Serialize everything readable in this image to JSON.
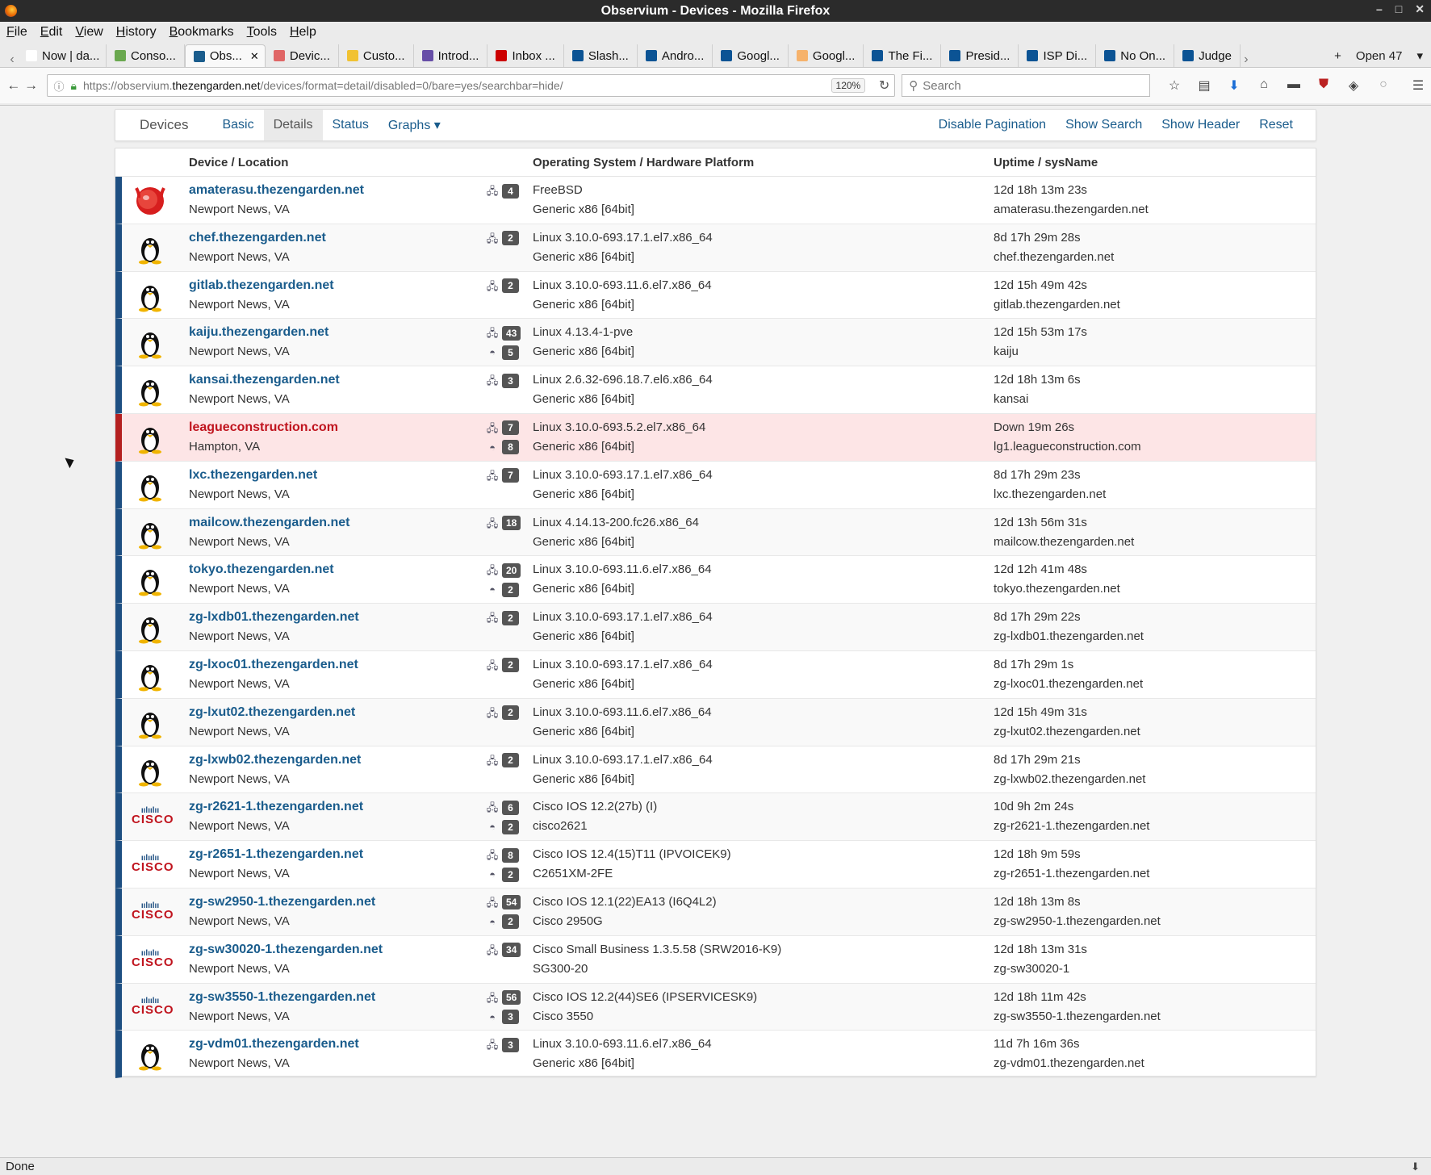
{
  "window": {
    "title": "Observium - Devices - Mozilla Firefox"
  },
  "menubar": [
    "File",
    "Edit",
    "View",
    "History",
    "Bookmarks",
    "Tools",
    "Help"
  ],
  "tabs": [
    {
      "label": "Now | da...",
      "color": "#ffffff"
    },
    {
      "label": "Conso...",
      "color": "#6aa84f"
    },
    {
      "label": "Obs...",
      "color": "#1a5c8c",
      "active": true
    },
    {
      "label": "Devic...",
      "color": "#e06666"
    },
    {
      "label": "Custo...",
      "color": "#f1c232"
    },
    {
      "label": "Introd...",
      "color": "#674ea7"
    },
    {
      "label": "Inbox ...",
      "color": "#cc0000"
    },
    {
      "label": "Slash...",
      "color": "#0b5394"
    },
    {
      "label": "Andro...",
      "color": "#0b5394"
    },
    {
      "label": "Googl...",
      "color": "#0b5394"
    },
    {
      "label": "Googl...",
      "color": "#f6b26b"
    },
    {
      "label": "The Fi...",
      "color": "#0b5394"
    },
    {
      "label": "Presid...",
      "color": "#0b5394"
    },
    {
      "label": "ISP Di...",
      "color": "#0b5394"
    },
    {
      "label": "No On...",
      "color": "#0b5394"
    },
    {
      "label": "Judge",
      "color": "#0b5394"
    }
  ],
  "tab_overflow": "Open 47",
  "url": {
    "prefix": "https://observium.",
    "domain": "thezengarden.net",
    "path": "/devices/format=detail/disabled=0/bare=yes/searchbar=hide/",
    "zoom": "120%"
  },
  "search_placeholder": "Search",
  "nav": {
    "brand": "Devices",
    "links": [
      "Basic",
      "Details",
      "Status",
      "Graphs ▾"
    ],
    "right": [
      "Disable Pagination",
      "Show Search",
      "Show Header",
      "Reset"
    ]
  },
  "columns": {
    "device": "Device / Location",
    "os": "Operating System / Hardware Platform",
    "uptime": "Uptime / sysName"
  },
  "devices": [
    {
      "host": "amaterasu.thezengarden.net",
      "location": "Newport News, VA",
      "os": "FreeBSD",
      "hw": "Generic x86 [64bit]",
      "uptime": "12d 18h 13m 23s",
      "sysname": "amaterasu.thezengarden.net",
      "ports": "4",
      "sensors": "",
      "icon": "freebsd-icon",
      "status": "up"
    },
    {
      "host": "chef.thezengarden.net",
      "location": "Newport News, VA",
      "os": "Linux 3.10.0-693.17.1.el7.x86_64",
      "hw": "Generic x86 [64bit]",
      "uptime": "8d 17h 29m 28s",
      "sysname": "chef.thezengarden.net",
      "ports": "2",
      "sensors": "",
      "icon": "linux-icon",
      "status": "up"
    },
    {
      "host": "gitlab.thezengarden.net",
      "location": "Newport News, VA",
      "os": "Linux 3.10.0-693.11.6.el7.x86_64",
      "hw": "Generic x86 [64bit]",
      "uptime": "12d 15h 49m 42s",
      "sysname": "gitlab.thezengarden.net",
      "ports": "2",
      "sensors": "",
      "icon": "linux-icon",
      "status": "up"
    },
    {
      "host": "kaiju.thezengarden.net",
      "location": "Newport News, VA",
      "os": "Linux 4.13.4-1-pve",
      "hw": "Generic x86 [64bit]",
      "uptime": "12d 15h 53m 17s",
      "sysname": "kaiju",
      "ports": "43",
      "sensors": "5",
      "icon": "linux-icon",
      "status": "up"
    },
    {
      "host": "kansai.thezengarden.net",
      "location": "Newport News, VA",
      "os": "Linux 2.6.32-696.18.7.el6.x86_64",
      "hw": "Generic x86 [64bit]",
      "uptime": "12d 18h 13m 6s",
      "sysname": "kansai",
      "ports": "3",
      "sensors": "",
      "icon": "linux-icon",
      "status": "up"
    },
    {
      "host": "leagueconstruction.com",
      "location": "Hampton, VA",
      "os": "Linux 3.10.0-693.5.2.el7.x86_64",
      "hw": "Generic x86 [64bit]",
      "uptime": "Down 19m 26s",
      "sysname": "lg1.leagueconstruction.com",
      "ports": "7",
      "sensors": "8",
      "icon": "linux-icon",
      "status": "down"
    },
    {
      "host": "lxc.thezengarden.net",
      "location": "Newport News, VA",
      "os": "Linux 3.10.0-693.17.1.el7.x86_64",
      "hw": "Generic x86 [64bit]",
      "uptime": "8d 17h 29m 23s",
      "sysname": "lxc.thezengarden.net",
      "ports": "7",
      "sensors": "",
      "icon": "linux-icon",
      "status": "up"
    },
    {
      "host": "mailcow.thezengarden.net",
      "location": "Newport News, VA",
      "os": "Linux 4.14.13-200.fc26.x86_64",
      "hw": "Generic x86 [64bit]",
      "uptime": "12d 13h 56m 31s",
      "sysname": "mailcow.thezengarden.net",
      "ports": "18",
      "sensors": "",
      "icon": "linux-icon",
      "status": "up"
    },
    {
      "host": "tokyo.thezengarden.net",
      "location": "Newport News, VA",
      "os": "Linux 3.10.0-693.11.6.el7.x86_64",
      "hw": "Generic x86 [64bit]",
      "uptime": "12d 12h 41m 48s",
      "sysname": "tokyo.thezengarden.net",
      "ports": "20",
      "sensors": "2",
      "icon": "linux-icon",
      "status": "up"
    },
    {
      "host": "zg-lxdb01.thezengarden.net",
      "location": "Newport News, VA",
      "os": "Linux 3.10.0-693.17.1.el7.x86_64",
      "hw": "Generic x86 [64bit]",
      "uptime": "8d 17h 29m 22s",
      "sysname": "zg-lxdb01.thezengarden.net",
      "ports": "2",
      "sensors": "",
      "icon": "linux-icon",
      "status": "up"
    },
    {
      "host": "zg-lxoc01.thezengarden.net",
      "location": "Newport News, VA",
      "os": "Linux 3.10.0-693.17.1.el7.x86_64",
      "hw": "Generic x86 [64bit]",
      "uptime": "8d 17h 29m 1s",
      "sysname": "zg-lxoc01.thezengarden.net",
      "ports": "2",
      "sensors": "",
      "icon": "linux-icon",
      "status": "up"
    },
    {
      "host": "zg-lxut02.thezengarden.net",
      "location": "Newport News, VA",
      "os": "Linux 3.10.0-693.11.6.el7.x86_64",
      "hw": "Generic x86 [64bit]",
      "uptime": "12d 15h 49m 31s",
      "sysname": "zg-lxut02.thezengarden.net",
      "ports": "2",
      "sensors": "",
      "icon": "linux-icon",
      "status": "up"
    },
    {
      "host": "zg-lxwb02.thezengarden.net",
      "location": "Newport News, VA",
      "os": "Linux 3.10.0-693.17.1.el7.x86_64",
      "hw": "Generic x86 [64bit]",
      "uptime": "8d 17h 29m 21s",
      "sysname": "zg-lxwb02.thezengarden.net",
      "ports": "2",
      "sensors": "",
      "icon": "linux-icon",
      "status": "up"
    },
    {
      "host": "zg-r2621-1.thezengarden.net",
      "location": "Newport News, VA",
      "os": "Cisco IOS 12.2(27b) (I)",
      "hw": "cisco2621",
      "uptime": "10d 9h 2m 24s",
      "sysname": "zg-r2621-1.thezengarden.net",
      "ports": "6",
      "sensors": "2",
      "icon": "cisco-icon",
      "status": "up"
    },
    {
      "host": "zg-r2651-1.thezengarden.net",
      "location": "Newport News, VA",
      "os": "Cisco IOS 12.4(15)T11 (IPVOICEK9)",
      "hw": "C2651XM-2FE",
      "uptime": "12d 18h 9m 59s",
      "sysname": "zg-r2651-1.thezengarden.net",
      "ports": "8",
      "sensors": "2",
      "icon": "cisco-icon",
      "status": "up"
    },
    {
      "host": "zg-sw2950-1.thezengarden.net",
      "location": "Newport News, VA",
      "os": "Cisco IOS 12.1(22)EA13 (I6Q4L2)",
      "hw": "Cisco 2950G",
      "uptime": "12d 18h 13m 8s",
      "sysname": "zg-sw2950-1.thezengarden.net",
      "ports": "54",
      "sensors": "2",
      "icon": "cisco-icon",
      "status": "up"
    },
    {
      "host": "zg-sw30020-1.thezengarden.net",
      "location": "Newport News, VA",
      "os": "Cisco Small Business 1.3.5.58 (SRW2016-K9)",
      "hw": "SG300-20",
      "uptime": "12d 18h 13m 31s",
      "sysname": "zg-sw30020-1",
      "ports": "34",
      "sensors": "",
      "icon": "cisco-icon",
      "status": "up"
    },
    {
      "host": "zg-sw3550-1.thezengarden.net",
      "location": "Newport News, VA",
      "os": "Cisco IOS 12.2(44)SE6 (IPSERVICESK9)",
      "hw": "Cisco 3550",
      "uptime": "12d 18h 11m 42s",
      "sysname": "zg-sw3550-1.thezengarden.net",
      "ports": "56",
      "sensors": "3",
      "icon": "cisco-icon",
      "status": "up"
    },
    {
      "host": "zg-vdm01.thezengarden.net",
      "location": "Newport News, VA",
      "os": "Linux 3.10.0-693.11.6.el7.x86_64",
      "hw": "Generic x86 [64bit]",
      "uptime": "11d 7h 16m 36s",
      "sysname": "zg-vdm01.thezengarden.net",
      "ports": "3",
      "sensors": "",
      "icon": "linux-icon",
      "status": "up"
    }
  ],
  "statusbar": "Done"
}
